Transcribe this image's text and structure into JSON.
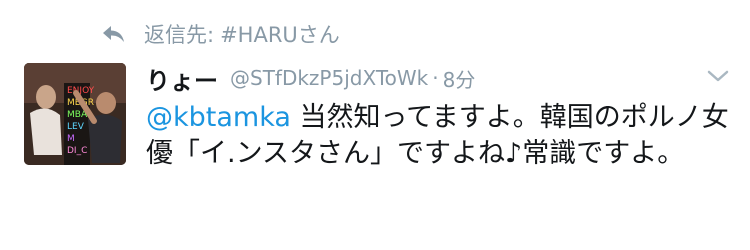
{
  "reply": {
    "prefix": "返信先:",
    "target": "#HARUさん"
  },
  "tweet": {
    "display_name": "りょー",
    "handle": "@STfDkzP5jdXToWk",
    "separator": "·",
    "time": "8分",
    "mention": "@kbtamka",
    "body": " 当然知ってますよ。韓国のポルノ女優「イ.ンスタさん」ですよね♪常識ですよ。"
  },
  "avatar": {
    "neon_lines": [
      "ENJOY",
      "MBGR",
      "MBA",
      "LEV",
      "M",
      "DI_C"
    ]
  },
  "colors": {
    "text": "#14171a",
    "muted": "#8899a6",
    "link": "#1b95e0",
    "background": "#ffffff"
  },
  "icons": [
    "reply-arrow-icon",
    "chevron-down-icon"
  ]
}
